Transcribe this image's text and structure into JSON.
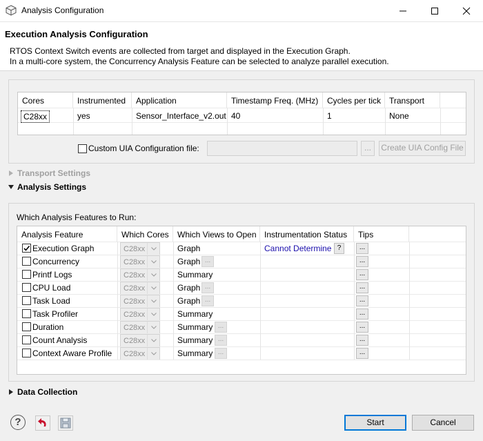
{
  "window": {
    "title": "Analysis Configuration"
  },
  "header": {
    "title": "Execution Analysis Configuration",
    "description_line1": "RTOS Context Switch events are collected from target and displayed in the Execution Graph.",
    "description_line2": "In a multi-core system, the Concurrency Analysis Feature can be selected to analyze parallel execution."
  },
  "cores_table": {
    "headers": [
      "Cores",
      "Instrumented",
      "Application",
      "Timestamp Freq. (MHz)",
      "Cycles per tick",
      "Transport"
    ],
    "rows": [
      {
        "core": "C28xx",
        "instrumented": "yes",
        "application": "Sensor_Interface_v2.out",
        "timestamp_freq": "40",
        "cycles_per_tick": "1",
        "transport": "None"
      }
    ]
  },
  "custom_uia": {
    "label": "Custom UIA Configuration file:",
    "value": "",
    "browse_label": "...",
    "create_label": "Create UIA Config File"
  },
  "sections": {
    "transport": "Transport Settings",
    "analysis": "Analysis Settings",
    "data_collection": "Data Collection"
  },
  "analysis": {
    "prompt": "Which Analysis Features to Run:",
    "headers": [
      "Analysis Feature",
      "Which Cores",
      "Which Views to Open",
      "Instrumentation Status",
      "Tips"
    ],
    "rows": [
      {
        "feature": "Execution Graph",
        "checked": true,
        "core": "C28xx",
        "view": "Graph",
        "view_btn": false,
        "status": "Cannot Determine",
        "status_btn": "?",
        "tips": "..."
      },
      {
        "feature": "Concurrency",
        "checked": false,
        "core": "C28xx",
        "view": "Graph",
        "view_btn": true,
        "status": "",
        "tips": "..."
      },
      {
        "feature": "Printf Logs",
        "checked": false,
        "core": "C28xx",
        "view": "Summary",
        "view_btn": false,
        "status": "",
        "tips": "..."
      },
      {
        "feature": "CPU Load",
        "checked": false,
        "core": "C28xx",
        "view": "Graph",
        "view_btn": true,
        "status": "",
        "tips": "..."
      },
      {
        "feature": "Task Load",
        "checked": false,
        "core": "C28xx",
        "view": "Graph",
        "view_btn": true,
        "status": "",
        "tips": "..."
      },
      {
        "feature": "Task Profiler",
        "checked": false,
        "core": "C28xx",
        "view": "Summary",
        "view_btn": false,
        "status": "",
        "tips": "..."
      },
      {
        "feature": "Duration",
        "checked": false,
        "core": "C28xx",
        "view": "Summary",
        "view_btn": true,
        "status": "",
        "tips": "..."
      },
      {
        "feature": "Count Analysis",
        "checked": false,
        "core": "C28xx",
        "view": "Summary",
        "view_btn": true,
        "status": "",
        "tips": "..."
      },
      {
        "feature": "Context Aware Profile",
        "checked": false,
        "core": "C28xx",
        "view": "Summary",
        "view_btn": true,
        "status": "",
        "tips": "..."
      }
    ]
  },
  "footer": {
    "start_label": "Start",
    "cancel_label": "Cancel"
  },
  "colors": {
    "status_link": "#1a0dab",
    "accent_border": "#0078d7",
    "red_icon": "#c8102e"
  }
}
